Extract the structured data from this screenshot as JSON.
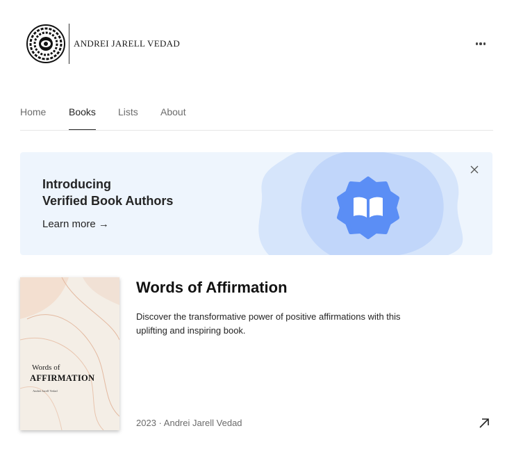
{
  "author": {
    "logo_text": "ANDREI JARELL VEDAD"
  },
  "icons": {
    "more": "more-dots-icon",
    "close": "close-icon",
    "book": "open-book-icon",
    "arrow": "arrow-up-right-icon"
  },
  "nav": {
    "tabs": [
      {
        "label": "Home"
      },
      {
        "label": "Books"
      },
      {
        "label": "Lists"
      },
      {
        "label": "About"
      }
    ],
    "active": "Books"
  },
  "banner": {
    "title_line1": "Introducing",
    "title_line2": "Verified Book Authors",
    "link_label": "Learn more →"
  },
  "book": {
    "title": "Words of Affirmation",
    "description": "Discover the transformative power of positive affirmations with this uplifting and inspiring book.",
    "year": "2023",
    "separator": "·",
    "author": "Andrei Jarell Vedad",
    "cover": {
      "line1": "Words of",
      "line2": "AFFIRMATION",
      "line3": "Andrei Jarell Vedad"
    }
  },
  "colors": {
    "banner_bg": "#eef5fd",
    "badge_blue": "#5b8ef5",
    "blob_light": "#d6e5fb",
    "blob_mid": "#c1d6fa"
  }
}
